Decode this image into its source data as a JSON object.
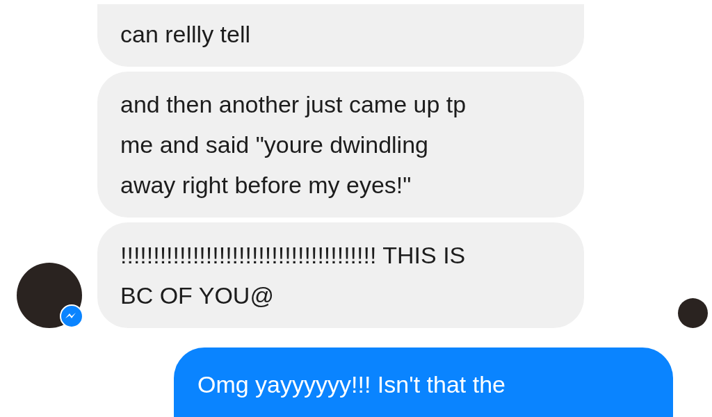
{
  "messages": [
    {
      "kind": "received",
      "text": "can rellly tell",
      "cut_top": true,
      "avatar": false
    },
    {
      "kind": "received",
      "text": "and then another just came up tp\nme and said \"youre dwindling\naway right before my eyes!\"",
      "cut_top": false,
      "avatar": false
    },
    {
      "kind": "received",
      "text": "!!!!!!!!!!!!!!!!!!!!!!!!!!!!!!!!!!!!!!! THIS IS\nBC OF YOU@",
      "cut_top": false,
      "avatar": true,
      "seen": true
    },
    {
      "kind": "sent",
      "text": "Omg yayyyyyy!!! Isn't that the"
    }
  ]
}
